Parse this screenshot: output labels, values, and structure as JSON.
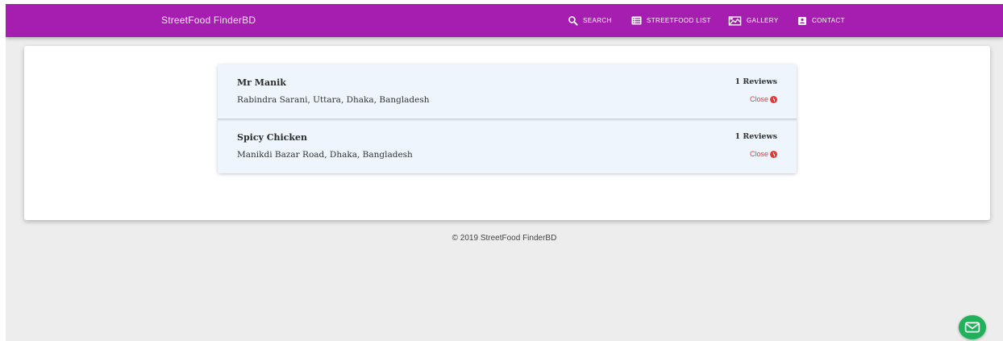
{
  "header": {
    "brand": "StreetFood FinderBD",
    "nav": [
      {
        "label": "SEARCH",
        "icon": "search-icon"
      },
      {
        "label": "STREETFOOD LIST",
        "icon": "list-icon"
      },
      {
        "label": "GALLERY",
        "icon": "gallery-icon"
      },
      {
        "label": "CONTACT",
        "icon": "contact-icon"
      }
    ]
  },
  "restaurants": [
    {
      "name": "Mr Manik",
      "address": "Rabindra Sarani, Uttara, Dhaka, Bangladesh",
      "reviews": "1 Reviews",
      "status": "Close"
    },
    {
      "name": "Spicy Chicken",
      "address": "Manikdi Bazar Road, Dhaka, Bangladesh",
      "reviews": "1 Reviews",
      "status": "Close"
    }
  ],
  "footer": {
    "text": "© 2019 StreetFood FinderBD"
  },
  "fab": {
    "icon": "mail-icon"
  },
  "colors": {
    "appbar": "#a61eb0",
    "closed": "#e53935",
    "fab": "#1fb25a",
    "list_bg": "#eef5fc"
  }
}
